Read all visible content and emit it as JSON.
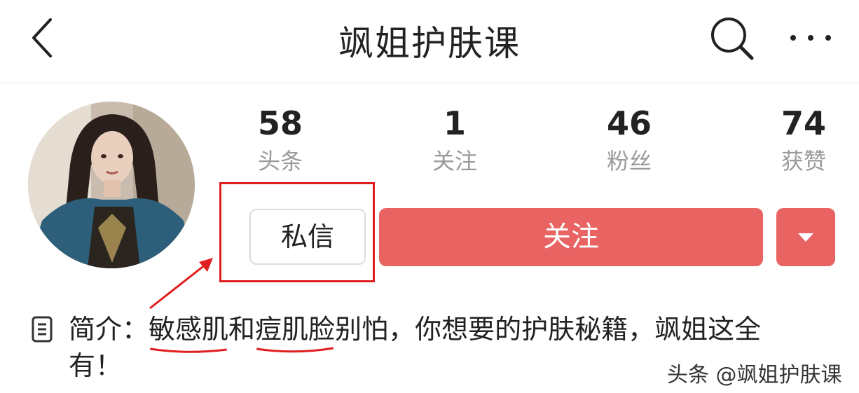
{
  "header": {
    "title": "飒姐护肤课",
    "back_icon": "chevron-left-icon",
    "search_icon": "search-icon",
    "more_icon": "more-dots-icon"
  },
  "profile": {
    "avatar": "avatar",
    "stats": [
      {
        "value": "58",
        "label": "头条"
      },
      {
        "value": "1",
        "label": "关注"
      },
      {
        "value": "46",
        "label": "粉丝"
      },
      {
        "value": "74",
        "label": "获赞"
      }
    ],
    "message_button": "私信",
    "follow_button": "关注",
    "dropdown_icon": "caret-down-icon"
  },
  "bio": {
    "icon": "document-icon",
    "prefix": "简介：",
    "part1": "敏感肌",
    "part2": "和",
    "part3": "痘肌脸",
    "part4": "别怕，你想要的护肤秘籍，飒姐这全有！"
  },
  "watermark": "头条 @飒姐护肤课",
  "colors": {
    "accent": "#e86362",
    "annotation": "#e02020"
  }
}
